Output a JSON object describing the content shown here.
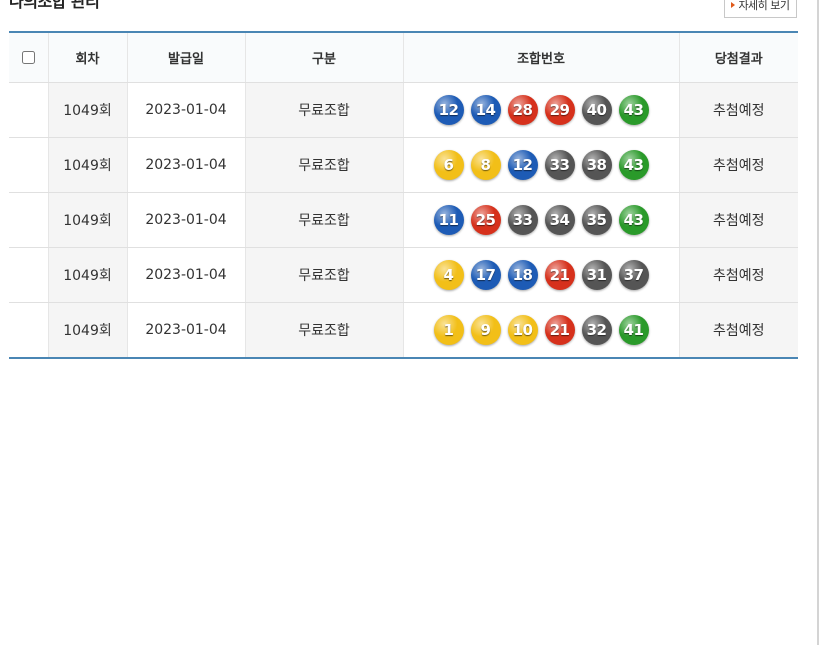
{
  "header": {
    "title": "나의조합 관리",
    "detail_button": "자세히 보기"
  },
  "table": {
    "columns": [
      "회차",
      "발급일",
      "구분",
      "조합번호",
      "당첨결과"
    ],
    "rows": [
      {
        "round": "1049회",
        "date": "2023-01-04",
        "type": "무료조합",
        "numbers": [
          12,
          14,
          28,
          29,
          40,
          43
        ],
        "result": "추첨예정"
      },
      {
        "round": "1049회",
        "date": "2023-01-04",
        "type": "무료조합",
        "numbers": [
          6,
          8,
          12,
          33,
          38,
          43
        ],
        "result": "추첨예정"
      },
      {
        "round": "1049회",
        "date": "2023-01-04",
        "type": "무료조합",
        "numbers": [
          11,
          25,
          33,
          34,
          35,
          43
        ],
        "result": "추첨예정"
      },
      {
        "round": "1049회",
        "date": "2023-01-04",
        "type": "무료조합",
        "numbers": [
          4,
          17,
          18,
          21,
          31,
          37
        ],
        "result": "추첨예정"
      },
      {
        "round": "1049회",
        "date": "2023-01-04",
        "type": "무료조합",
        "numbers": [
          1,
          9,
          10,
          21,
          32,
          41
        ],
        "result": "추첨예정"
      }
    ]
  },
  "ball_colors": {
    "yellow": "#f2bf18",
    "blue": "#1d5bb5",
    "red": "#d6311c",
    "gray": "#555555",
    "green": "#2a9a2a"
  },
  "colors": {
    "table_border": "#4a86b4",
    "accent_arrow": "#e05a1a"
  }
}
